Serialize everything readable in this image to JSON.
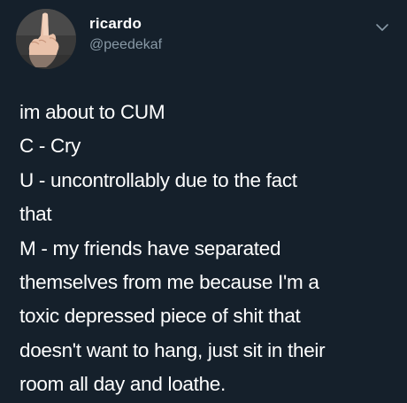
{
  "tweet": {
    "display_name": "ricardo",
    "handle": "@peedekaf",
    "lines": [
      "im about to CUM",
      "C - Cry",
      "U - uncontrollably due to the fact",
      "that",
      "M - my friends have separated",
      "themselves from me because I'm a",
      "toxic depressed piece of shit that",
      "doesn't want to hang, just sit in their",
      "room all day and loathe."
    ],
    "icons": {
      "avatar": "avatar-photo",
      "menu": "chevron-down-icon"
    }
  },
  "colors": {
    "background": "#15202b",
    "text": "#ffffff",
    "secondary_text": "#8899a6"
  }
}
